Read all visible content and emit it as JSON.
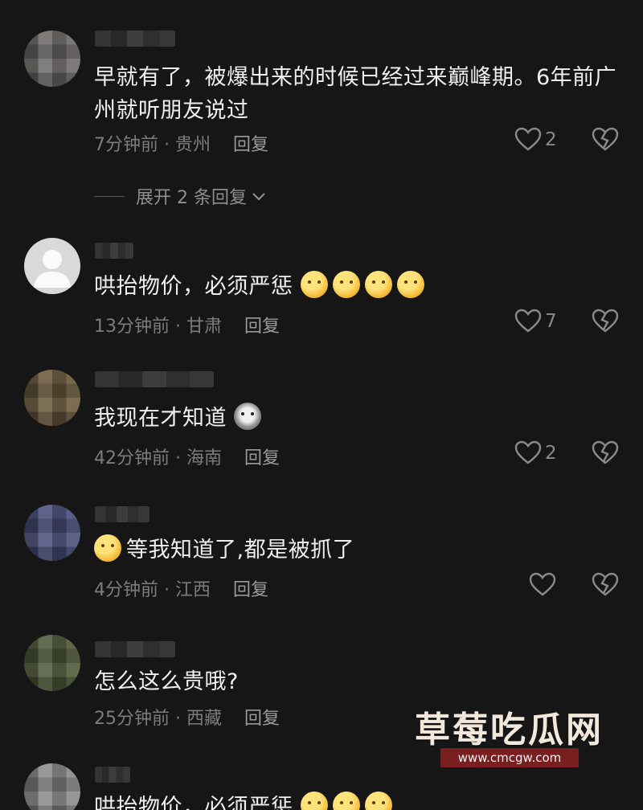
{
  "comments": [
    {
      "text": "早就有了，被爆出来的时候已经过来巅峰期。6年前广州就听朋友说过",
      "time": "7分钟前 · 贵州",
      "reply": "回复",
      "likes": "2",
      "expand": "展开 2 条回复",
      "avatar_color": "#6e6a6a"
    },
    {
      "text": "哄抬物价，必须严惩",
      "time": "13分钟前 · 甘肃",
      "reply": "回复",
      "likes": "7",
      "avatar_color": "#d9d9d9"
    },
    {
      "text": "我现在才知道",
      "time": "42分钟前 · 海南",
      "reply": "回复",
      "likes": "2",
      "avatar_color": "#6b5a3f"
    },
    {
      "text": "等我知道了,都是被抓了",
      "time": "4分钟前 · 江西",
      "reply": "回复",
      "likes": "",
      "avatar_color": "#4a4f7a"
    },
    {
      "text": "怎么这么贵哦?",
      "time": "25分钟前 · 西藏",
      "reply": "回复",
      "likes": "",
      "avatar_color": "#4f5a3a"
    },
    {
      "text": "哄抬物价，必须严惩",
      "avatar_color": "#8a8a8a"
    }
  ],
  "watermark": {
    "title": "草莓吃瓜网",
    "url": "www.cmcgw.com"
  },
  "colors": {
    "background": "#161616",
    "text": "#efefef",
    "meta": "#7c7c7c"
  },
  "icons": {
    "like": "heart-outline-icon",
    "dislike": "broken-heart-icon",
    "expand": "chevron-down-icon"
  }
}
